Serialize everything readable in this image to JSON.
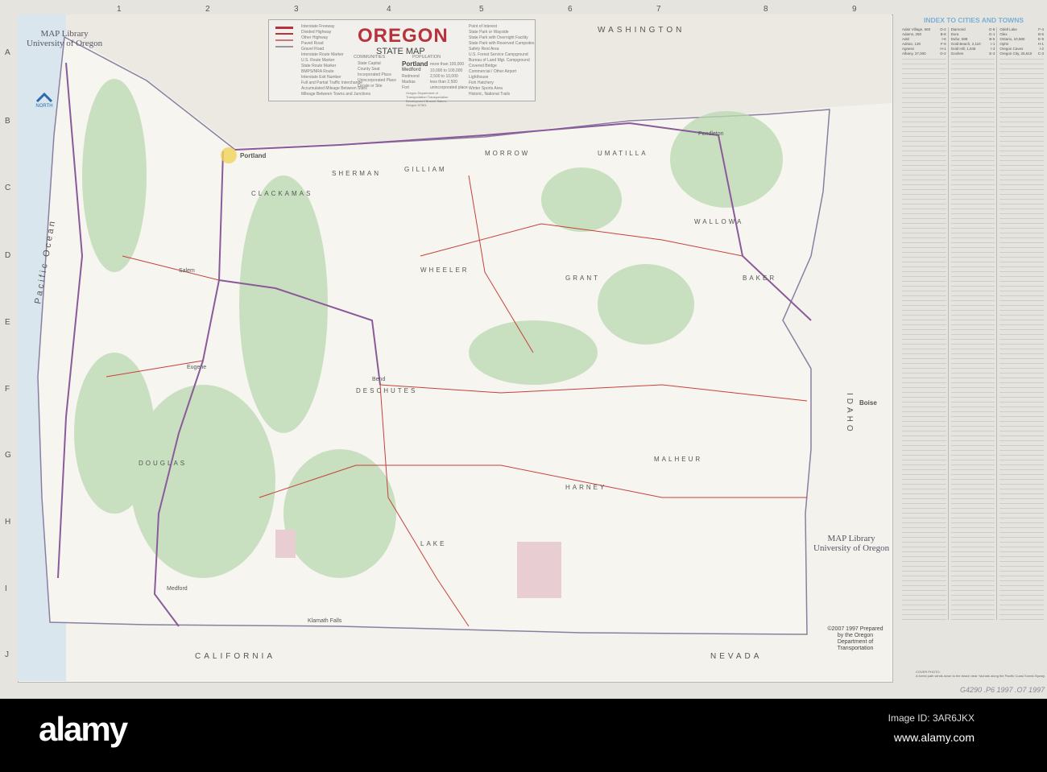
{
  "map": {
    "title": "OREGON",
    "subtitle": "STATE MAP",
    "library_label_line1": "MAP Library",
    "library_label_line2": "University of Oregon",
    "north_label": "NORTH",
    "ocean_label": "Pacific Ocean",
    "neighbors": {
      "washington": "WASHINGTON",
      "idaho": "IDAHO",
      "nevada": "NEVADA",
      "california": "CALIFORNIA"
    },
    "counties": [
      "MALHEUR",
      "HARNEY",
      "LAKE",
      "GRANT",
      "WHEELER",
      "UMATILLA",
      "MORROW",
      "GILLIAM",
      "SHERMAN",
      "WALLOWA",
      "DESCHUTES",
      "DOUGLAS",
      "CLACKAMAS",
      "BAKER"
    ],
    "cities": {
      "portland": "Portland",
      "salem": "Salem",
      "eugene": "Eugene",
      "medford": "Medford",
      "bend": "Bend",
      "pendleton": "Pendleton",
      "klamath": "Klamath Falls",
      "boise": "Boise"
    },
    "grid_letters": [
      "A",
      "B",
      "C",
      "D",
      "E",
      "F",
      "G",
      "H",
      "I",
      "J"
    ],
    "grid_numbers": [
      "1",
      "2",
      "3",
      "4",
      "5",
      "6",
      "7",
      "8",
      "9"
    ],
    "legend": {
      "left_items": [
        "Interstate Freeway",
        "Divided Highway",
        "Other Highway",
        "Paved Road",
        "Gravel Road",
        "Interstate Route Marker",
        "U.S. Route Marker",
        "State Route Marker",
        "BMPS/NRA Route",
        "Interstate Exit Number",
        "Full and Partial Traffic Interchange",
        "Accumulated Mileage Between Stars",
        "Mileage Between Towns and Junctions"
      ],
      "communities_header": "COMMUNITIES",
      "communities": [
        "State Capital",
        "County Seat",
        "Incorporated Place",
        "Unincorporated Place",
        "Locale or Site"
      ],
      "population_header": "POPULATION",
      "population": [
        [
          "Portland",
          "more than 100,000"
        ],
        [
          "Medford",
          "10,000 to 100,000"
        ],
        [
          "Redmond",
          "2,500 to 10,000"
        ],
        [
          "Madras",
          "less than 2,500"
        ],
        [
          "Fort",
          "unincorporated place"
        ]
      ],
      "right_items": [
        "Point of Interest",
        "State Park or Wayside",
        "State Park with Overnight Facility",
        "State Park with Reserved Campsites",
        "Safety Rest Area",
        "U.S. Forest Service Campground",
        "Bureau of Land Mgt. Campground",
        "Covered Bridge",
        "Commercial / Other Airport",
        "Lighthouse",
        "Fish Hatchery",
        "Winter Sports Area",
        "Historic, National Trails"
      ],
      "credit": "Oregon Department of Transportation Transportation Development Branch Salem, Oregon 97301"
    },
    "copyright": "©2007 1997 Prepared by the Oregon Department of Transportation"
  },
  "index": {
    "header": "INDEX TO CITIES AND TOWNS",
    "columns": [
      [
        [
          "Adair Village, 560",
          "D-2"
        ],
        [
          "Adams, 260",
          "B-8"
        ],
        [
          "Adel",
          "I-6"
        ],
        [
          "Adrian, 130",
          "F-9"
        ],
        [
          "Agness",
          "H-1"
        ],
        [
          "Albany, 37,000",
          "D-2"
        ]
      ],
      [
        [
          "Diamond",
          "G-8"
        ],
        [
          "Dora",
          "G-1"
        ],
        [
          "Dufur, 588",
          "B-5"
        ],
        [
          "Gold Beach, 2,110",
          "I-1"
        ],
        [
          "Gold Hill, 1,045",
          "I-3"
        ],
        [
          "Goshen",
          "E-3"
        ]
      ],
      [
        [
          "Odell Lake",
          "F-4"
        ],
        [
          "Olex",
          "B-6"
        ],
        [
          "Ontario, 10,580",
          "E-9"
        ],
        [
          "Ophir",
          "H-1"
        ],
        [
          "Oregon Caves",
          "I-2"
        ],
        [
          "Oregon City, 25,610",
          "C-3"
        ]
      ]
    ],
    "cover_photo_label": "COVER PHOTO:",
    "cover_photo_text": "A forest path winds down to the beach near Yachats along the Pacific Coast Scenic Byway.",
    "handwritten_note": "G4290 .P6 1997 .O7 1997"
  },
  "watermark": {
    "logo": "alamy",
    "image_id": "Image ID: 3AR6JKX",
    "url": "www.alamy.com"
  }
}
